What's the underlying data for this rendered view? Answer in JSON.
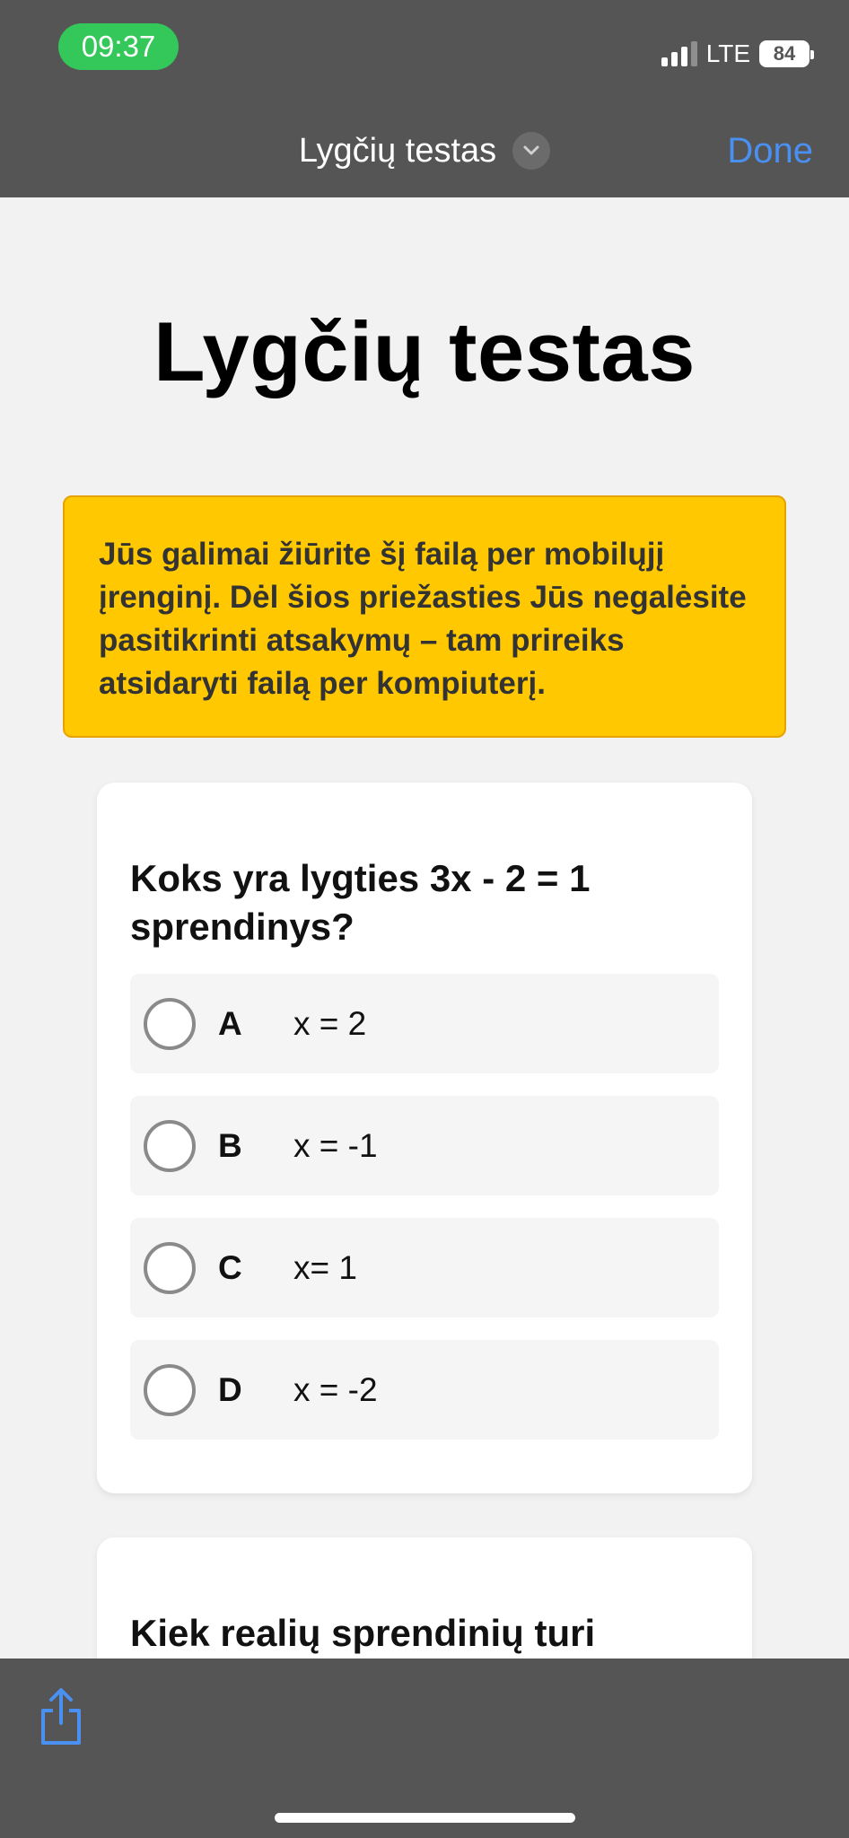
{
  "status_bar": {
    "time": "09:37",
    "network": "LTE",
    "battery": "84",
    "accent_color": "#34c759"
  },
  "nav": {
    "title": "Lygčių testas",
    "done_label": "Done",
    "done_color": "#4a90f0"
  },
  "page": {
    "title": "Lygčių testas",
    "warning": "Jūs galimai žiūrite šį failą per mobilųjį įrenginį. Dėl šios priežasties Jūs negalėsite pasitikrinti atsakymų – tam prireiks atsidaryti failą per kompiuterį.",
    "warning_color": "#ffc800"
  },
  "questions": [
    {
      "text": "Koks yra lygties 3x - 2 = 1 sprendinys?",
      "options": [
        {
          "letter": "A",
          "text": "x = 2"
        },
        {
          "letter": "B",
          "text": "x = -1"
        },
        {
          "letter": "C",
          "text": "x= 1"
        },
        {
          "letter": "D",
          "text": "x = -2"
        }
      ]
    },
    {
      "text": "Kiek realių sprendinių turi"
    }
  ],
  "toolbar": {
    "share_icon": "share-icon"
  }
}
